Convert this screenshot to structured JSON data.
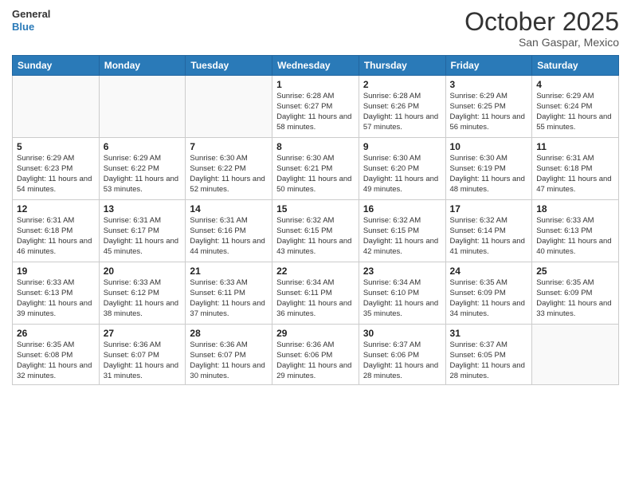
{
  "logo": {
    "line1": "General",
    "line2": "Blue"
  },
  "title": "October 2025",
  "location": "San Gaspar, Mexico",
  "weekdays": [
    "Sunday",
    "Monday",
    "Tuesday",
    "Wednesday",
    "Thursday",
    "Friday",
    "Saturday"
  ],
  "weeks": [
    [
      {
        "day": "",
        "sunrise": "",
        "sunset": "",
        "daylight": ""
      },
      {
        "day": "",
        "sunrise": "",
        "sunset": "",
        "daylight": ""
      },
      {
        "day": "",
        "sunrise": "",
        "sunset": "",
        "daylight": ""
      },
      {
        "day": "1",
        "sunrise": "6:28 AM",
        "sunset": "6:27 PM",
        "daylight": "11 hours and 58 minutes."
      },
      {
        "day": "2",
        "sunrise": "6:28 AM",
        "sunset": "6:26 PM",
        "daylight": "11 hours and 57 minutes."
      },
      {
        "day": "3",
        "sunrise": "6:29 AM",
        "sunset": "6:25 PM",
        "daylight": "11 hours and 56 minutes."
      },
      {
        "day": "4",
        "sunrise": "6:29 AM",
        "sunset": "6:24 PM",
        "daylight": "11 hours and 55 minutes."
      }
    ],
    [
      {
        "day": "5",
        "sunrise": "6:29 AM",
        "sunset": "6:23 PM",
        "daylight": "11 hours and 54 minutes."
      },
      {
        "day": "6",
        "sunrise": "6:29 AM",
        "sunset": "6:22 PM",
        "daylight": "11 hours and 53 minutes."
      },
      {
        "day": "7",
        "sunrise": "6:30 AM",
        "sunset": "6:22 PM",
        "daylight": "11 hours and 52 minutes."
      },
      {
        "day": "8",
        "sunrise": "6:30 AM",
        "sunset": "6:21 PM",
        "daylight": "11 hours and 50 minutes."
      },
      {
        "day": "9",
        "sunrise": "6:30 AM",
        "sunset": "6:20 PM",
        "daylight": "11 hours and 49 minutes."
      },
      {
        "day": "10",
        "sunrise": "6:30 AM",
        "sunset": "6:19 PM",
        "daylight": "11 hours and 48 minutes."
      },
      {
        "day": "11",
        "sunrise": "6:31 AM",
        "sunset": "6:18 PM",
        "daylight": "11 hours and 47 minutes."
      }
    ],
    [
      {
        "day": "12",
        "sunrise": "6:31 AM",
        "sunset": "6:18 PM",
        "daylight": "11 hours and 46 minutes."
      },
      {
        "day": "13",
        "sunrise": "6:31 AM",
        "sunset": "6:17 PM",
        "daylight": "11 hours and 45 minutes."
      },
      {
        "day": "14",
        "sunrise": "6:31 AM",
        "sunset": "6:16 PM",
        "daylight": "11 hours and 44 minutes."
      },
      {
        "day": "15",
        "sunrise": "6:32 AM",
        "sunset": "6:15 PM",
        "daylight": "11 hours and 43 minutes."
      },
      {
        "day": "16",
        "sunrise": "6:32 AM",
        "sunset": "6:15 PM",
        "daylight": "11 hours and 42 minutes."
      },
      {
        "day": "17",
        "sunrise": "6:32 AM",
        "sunset": "6:14 PM",
        "daylight": "11 hours and 41 minutes."
      },
      {
        "day": "18",
        "sunrise": "6:33 AM",
        "sunset": "6:13 PM",
        "daylight": "11 hours and 40 minutes."
      }
    ],
    [
      {
        "day": "19",
        "sunrise": "6:33 AM",
        "sunset": "6:13 PM",
        "daylight": "11 hours and 39 minutes."
      },
      {
        "day": "20",
        "sunrise": "6:33 AM",
        "sunset": "6:12 PM",
        "daylight": "11 hours and 38 minutes."
      },
      {
        "day": "21",
        "sunrise": "6:33 AM",
        "sunset": "6:11 PM",
        "daylight": "11 hours and 37 minutes."
      },
      {
        "day": "22",
        "sunrise": "6:34 AM",
        "sunset": "6:11 PM",
        "daylight": "11 hours and 36 minutes."
      },
      {
        "day": "23",
        "sunrise": "6:34 AM",
        "sunset": "6:10 PM",
        "daylight": "11 hours and 35 minutes."
      },
      {
        "day": "24",
        "sunrise": "6:35 AM",
        "sunset": "6:09 PM",
        "daylight": "11 hours and 34 minutes."
      },
      {
        "day": "25",
        "sunrise": "6:35 AM",
        "sunset": "6:09 PM",
        "daylight": "11 hours and 33 minutes."
      }
    ],
    [
      {
        "day": "26",
        "sunrise": "6:35 AM",
        "sunset": "6:08 PM",
        "daylight": "11 hours and 32 minutes."
      },
      {
        "day": "27",
        "sunrise": "6:36 AM",
        "sunset": "6:07 PM",
        "daylight": "11 hours and 31 minutes."
      },
      {
        "day": "28",
        "sunrise": "6:36 AM",
        "sunset": "6:07 PM",
        "daylight": "11 hours and 30 minutes."
      },
      {
        "day": "29",
        "sunrise": "6:36 AM",
        "sunset": "6:06 PM",
        "daylight": "11 hours and 29 minutes."
      },
      {
        "day": "30",
        "sunrise": "6:37 AM",
        "sunset": "6:06 PM",
        "daylight": "11 hours and 28 minutes."
      },
      {
        "day": "31",
        "sunrise": "6:37 AM",
        "sunset": "6:05 PM",
        "daylight": "11 hours and 28 minutes."
      },
      {
        "day": "",
        "sunrise": "",
        "sunset": "",
        "daylight": ""
      }
    ]
  ]
}
